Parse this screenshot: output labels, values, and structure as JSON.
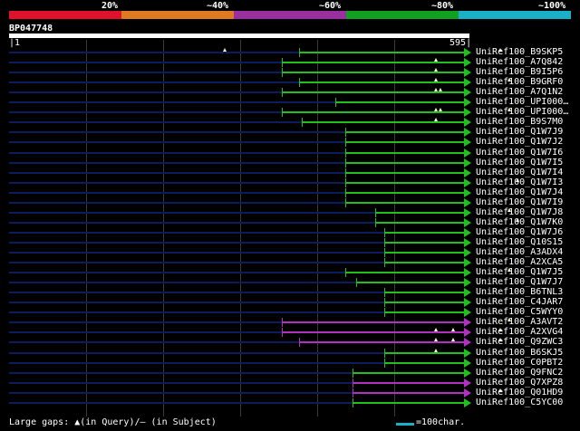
{
  "header": {
    "scale_labels": [
      "20%",
      "~40%",
      "~60%",
      "~80%",
      "~100%"
    ],
    "scale_colors": [
      "#e0112c",
      "#e07a20",
      "#9a2fa0",
      "#12a020",
      "#1ab0c8"
    ],
    "query_id": "BP047748",
    "start_pos": "1",
    "end_pos": "595"
  },
  "colors": {
    "hit_high": "#22c01e",
    "hit_mid": "#b030c0",
    "unaligned": "#0c1c5c",
    "gap_marker": "#ffffcc"
  },
  "hits": [
    {
      "label": "UniRef100_B9SKP5",
      "start": 330,
      "level": "high",
      "marks": [
        248,
        552
      ]
    },
    {
      "label": "UniRef100_A7Q842",
      "start": 311,
      "level": "high",
      "marks": [
        481
      ]
    },
    {
      "label": "UniRef100_B9I5P6",
      "start": 311,
      "level": "high",
      "marks": [
        481
      ]
    },
    {
      "label": "UniRef100_B9GRF0",
      "start": 330,
      "level": "high",
      "marks": [
        481,
        562
      ]
    },
    {
      "label": "UniRef100_A7Q1N2",
      "start": 311,
      "level": "high",
      "marks": [
        481,
        486
      ]
    },
    {
      "label": "UniRef100_UPI000…",
      "start": 370,
      "level": "high",
      "marks": []
    },
    {
      "label": "UniRef100_UPI000…",
      "start": 311,
      "level": "high",
      "marks": [
        481,
        486,
        562
      ]
    },
    {
      "label": "UniRef100_B9S7M0",
      "start": 333,
      "level": "high",
      "marks": [
        481
      ]
    },
    {
      "label": "UniRef100_Q1W7J9",
      "start": 381,
      "level": "high",
      "marks": []
    },
    {
      "label": "UniRef100_Q1W7J2",
      "start": 381,
      "level": "high",
      "marks": []
    },
    {
      "label": "UniRef100_Q1W7I6",
      "start": 381,
      "level": "high",
      "marks": []
    },
    {
      "label": "UniRef100_Q1W7I5",
      "start": 381,
      "level": "high",
      "marks": []
    },
    {
      "label": "UniRef100_Q1W7I4",
      "start": 381,
      "level": "high",
      "marks": []
    },
    {
      "label": "UniRef100_Q1W7I3",
      "start": 381,
      "level": "high",
      "marks": [
        571
      ]
    },
    {
      "label": "UniRef100_Q1W7J4",
      "start": 381,
      "level": "high",
      "marks": []
    },
    {
      "label": "UniRef100_Q1W7I9",
      "start": 381,
      "level": "high",
      "marks": []
    },
    {
      "label": "UniRef100_Q1W7J8",
      "start": 414,
      "level": "high",
      "marks": [
        562
      ]
    },
    {
      "label": "UniRef100_Q1W7K0",
      "start": 414,
      "level": "high",
      "marks": [
        571
      ]
    },
    {
      "label": "UniRef100_Q1W7J6",
      "start": 424,
      "level": "high",
      "marks": []
    },
    {
      "label": "UniRef100_Q10S15",
      "start": 424,
      "level": "high",
      "marks": []
    },
    {
      "label": "UniRef100_A3ADX4",
      "start": 424,
      "level": "high",
      "marks": []
    },
    {
      "label": "UniRef100_A2XCA5",
      "start": 424,
      "level": "high",
      "marks": []
    },
    {
      "label": "UniRef100_Q1W7J5",
      "start": 381,
      "level": "high",
      "marks": [
        562
      ]
    },
    {
      "label": "UniRef100_Q1W7J7",
      "start": 393,
      "level": "high",
      "marks": []
    },
    {
      "label": "UniRef100_B6TNL3",
      "start": 424,
      "level": "high",
      "marks": []
    },
    {
      "label": "UniRef100_C4JAR7",
      "start": 424,
      "level": "high",
      "marks": []
    },
    {
      "label": "UniRef100_C5WYY0",
      "start": 424,
      "level": "high",
      "marks": []
    },
    {
      "label": "UniRef100_A3AVT2",
      "start": 311,
      "level": "mid",
      "marks": [
        562
      ]
    },
    {
      "label": "UniRef100_A2XVG4",
      "start": 311,
      "level": "mid",
      "marks": [
        481,
        500,
        552
      ]
    },
    {
      "label": "UniRef100_Q9ZWC3",
      "start": 330,
      "level": "mid",
      "marks": [
        481,
        500,
        552
      ]
    },
    {
      "label": "UniRef100_B6SKJ5",
      "start": 424,
      "level": "high",
      "marks": [
        481
      ]
    },
    {
      "label": "UniRef100_C0PBT2",
      "start": 424,
      "level": "high",
      "marks": []
    },
    {
      "label": "UniRef100_Q9FNC2",
      "start": 389,
      "level": "high",
      "marks": []
    },
    {
      "label": "UniRef100_Q7XPZ8",
      "start": 389,
      "level": "mid",
      "marks": []
    },
    {
      "label": "UniRef100_Q01HD9",
      "start": 389,
      "level": "mid",
      "marks": [
        552
      ]
    },
    {
      "label": "UniRef100_C5YC00",
      "start": 389,
      "level": "high",
      "marks": []
    }
  ],
  "footer": {
    "legend_text": "Large gaps: ▲(in Query)/– (in Subject)",
    "scale_text": "=100char."
  }
}
